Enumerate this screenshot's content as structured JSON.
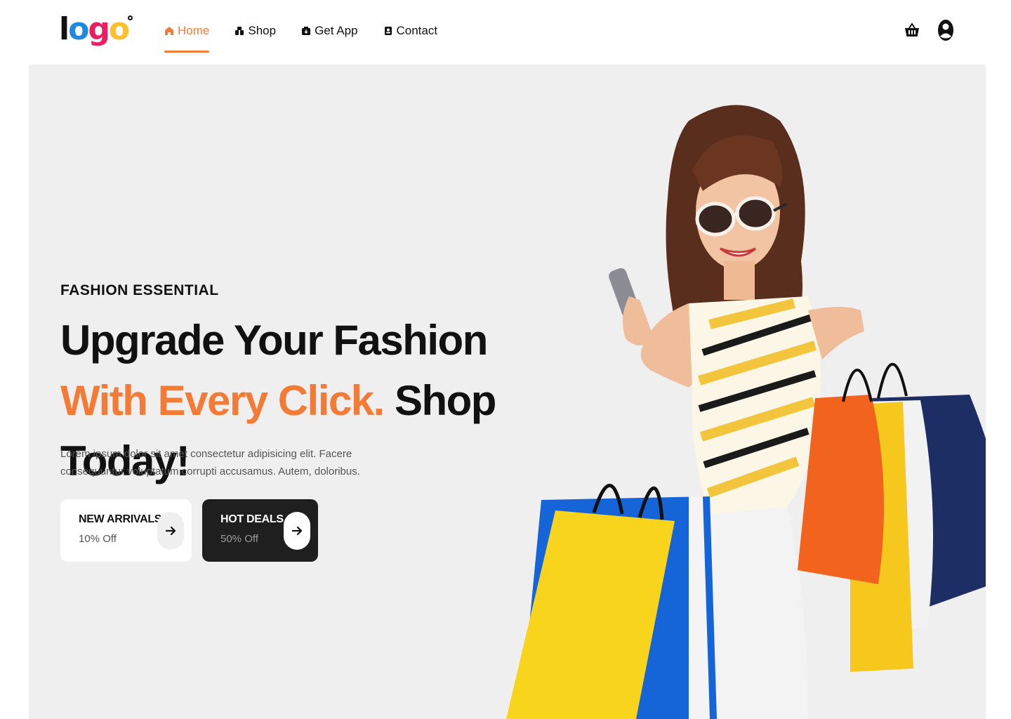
{
  "header": {
    "logo": {
      "text": "logo"
    },
    "nav": [
      {
        "label": "Home",
        "icon": "home-icon",
        "active": true
      },
      {
        "label": "Shop",
        "icon": "shop-icon",
        "active": false
      },
      {
        "label": "Get App",
        "icon": "app-icon",
        "active": false
      },
      {
        "label": "Contact",
        "icon": "contact-icon",
        "active": false
      }
    ],
    "actions": [
      {
        "icon": "basket-icon"
      },
      {
        "icon": "user-icon"
      }
    ]
  },
  "hero": {
    "eyebrow": "FASHION ESSENTIAL",
    "headline": {
      "part1": "Upgrade Your Fashion ",
      "part2_accent": "With Every Click.",
      "part3": " Shop Today!"
    },
    "description": "Lorem ipsum dolor sit amet consectetur adipisicing elit. Facere consequuntur voluptatum corrupti accusamus. Autem, doloribus.",
    "ctas": [
      {
        "title": "NEW ARRIVALS",
        "subtitle": "10% Off",
        "icon": "arrow-right-icon"
      },
      {
        "title": "HOT DEALS",
        "subtitle": "50% Off",
        "icon": "arrow-right-icon"
      }
    ]
  },
  "colors": {
    "accent": "#f47b36",
    "hero_bg": "#efefef",
    "dark": "#1f1f1f"
  }
}
